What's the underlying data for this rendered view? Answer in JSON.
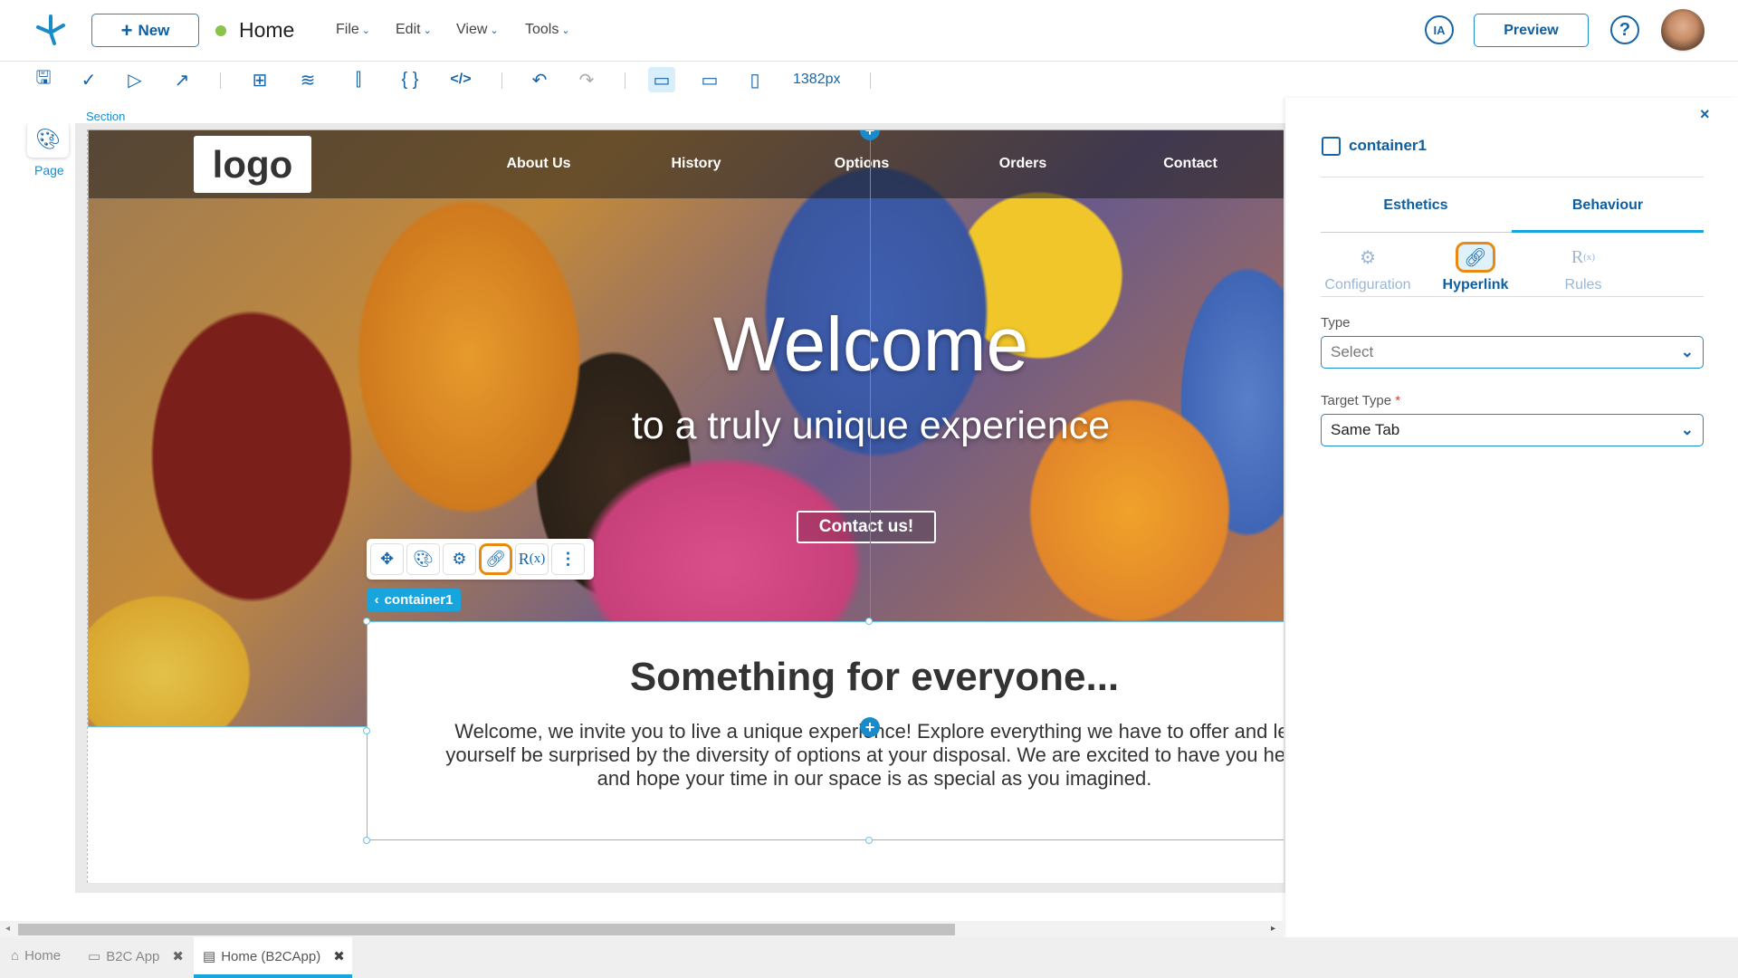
{
  "header": {
    "new_label": "New",
    "page_name": "Home",
    "status_color": "#8bc34a",
    "menus": [
      "File",
      "Edit",
      "View",
      "Tools"
    ],
    "ia_label": "IA",
    "preview_label": "Preview"
  },
  "toolbar": {
    "width_value": "1382px"
  },
  "left_sidebar": {
    "page_label": "Page"
  },
  "canvas": {
    "section_label": "Section",
    "hero": {
      "logo_text": "logo",
      "nav": [
        "About Us",
        "History",
        "Options",
        "Orders",
        "Contact"
      ],
      "title": "Welcome",
      "subtitle": "to a truly unique experience",
      "button": "Contact us!"
    },
    "container": {
      "tag": "container1",
      "title": "Something for everyone...",
      "lines": [
        "Welcome, we invite you to live a unique experience! Explore everything we have to offer and let",
        "yourself be surprised by the diversity of options at your disposal. We are excited to have you here",
        "and hope your time in our space is as special as you imagined."
      ]
    }
  },
  "panel": {
    "component_name": "container1",
    "tabs": [
      "Esthetics",
      "Behaviour"
    ],
    "active_tab": "Behaviour",
    "subtabs": [
      "Configuration",
      "Hyperlink",
      "Rules"
    ],
    "active_subtab": "Hyperlink",
    "type_label": "Type",
    "type_value": "Select",
    "target_label": "Target Type",
    "required_mark": "*",
    "target_value": "Same Tab"
  },
  "bottom_tabs": [
    {
      "label": "Home"
    },
    {
      "label": "B2C App"
    },
    {
      "label": "Home (B2CApp)",
      "active": true
    }
  ],
  "colors": {
    "accent": "#1a8bc9",
    "highlight": "#e88a12",
    "tag": "#18a5de"
  }
}
